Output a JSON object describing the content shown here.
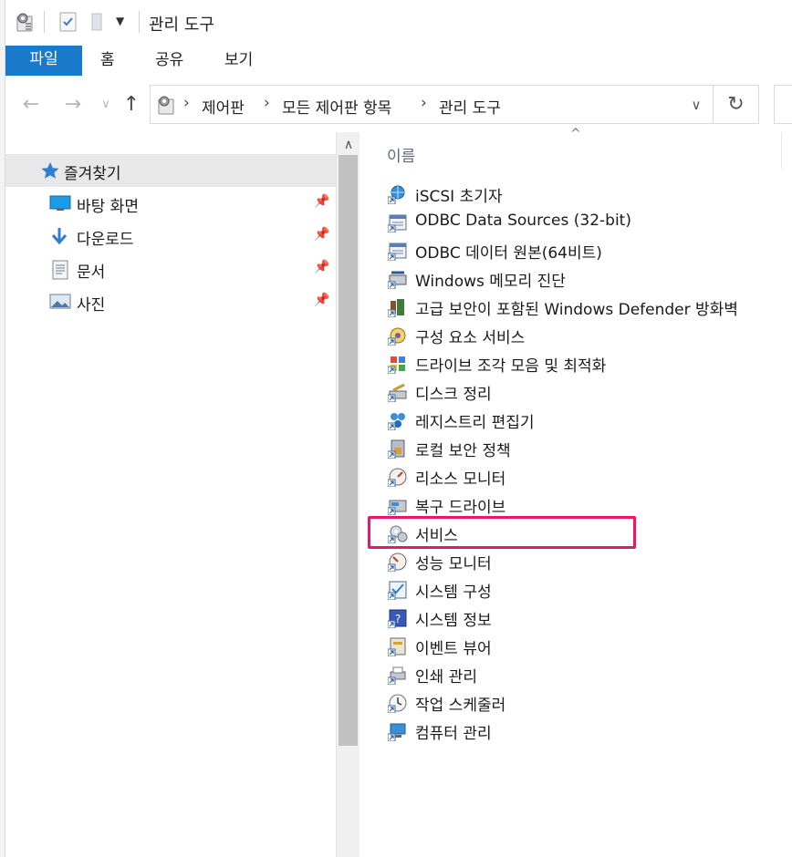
{
  "window": {
    "title": "관리 도구"
  },
  "ribbon": {
    "tabs": [
      "파일",
      "홈",
      "공유",
      "보기"
    ]
  },
  "address": {
    "breadcrumbs": [
      "제어판",
      "모든 제어판 항목",
      "관리 도구"
    ]
  },
  "navigation": {
    "quick_access_label": "즐겨찾기",
    "items": [
      {
        "label": "바탕 화면",
        "icon": "desktop-icon"
      },
      {
        "label": "다운로드",
        "icon": "download-icon"
      },
      {
        "label": "문서",
        "icon": "documents-icon"
      },
      {
        "label": "사진",
        "icon": "pictures-icon"
      }
    ]
  },
  "file_list": {
    "column_name": "이름",
    "items": [
      {
        "label": "iSCSI 초기자",
        "icon": "iscsi-icon"
      },
      {
        "label": "ODBC Data Sources (32-bit)",
        "icon": "odbc-icon"
      },
      {
        "label": "ODBC 데이터 원본(64비트)",
        "icon": "odbc-icon"
      },
      {
        "label": "Windows 메모리 진단",
        "icon": "memory-diagnostic-icon"
      },
      {
        "label": "고급 보안이 포함된 Windows Defender 방화벽",
        "icon": "firewall-icon"
      },
      {
        "label": "구성 요소 서비스",
        "icon": "component-services-icon"
      },
      {
        "label": "드라이브 조각 모음 및 최적화",
        "icon": "defrag-icon"
      },
      {
        "label": "디스크 정리",
        "icon": "disk-cleanup-icon"
      },
      {
        "label": "레지스트리 편집기",
        "icon": "registry-icon"
      },
      {
        "label": "로컬 보안 정책",
        "icon": "security-policy-icon"
      },
      {
        "label": "리소스 모니터",
        "icon": "resource-monitor-icon"
      },
      {
        "label": "복구 드라이브",
        "icon": "recovery-drive-icon"
      },
      {
        "label": "서비스",
        "icon": "services-icon"
      },
      {
        "label": "성능 모니터",
        "icon": "performance-monitor-icon"
      },
      {
        "label": "시스템 구성",
        "icon": "system-config-icon"
      },
      {
        "label": "시스템 정보",
        "icon": "system-info-icon"
      },
      {
        "label": "이벤트 뷰어",
        "icon": "event-viewer-icon"
      },
      {
        "label": "인쇄 관리",
        "icon": "print-management-icon"
      },
      {
        "label": "작업 스케줄러",
        "icon": "task-scheduler-icon"
      },
      {
        "label": "컴퓨터 관리",
        "icon": "computer-management-icon"
      }
    ],
    "highlighted": "서비스"
  },
  "colors": {
    "file_tab": "#1979ca",
    "highlight_border": "#e8176b",
    "selected_nav": "#e8e8e8"
  }
}
